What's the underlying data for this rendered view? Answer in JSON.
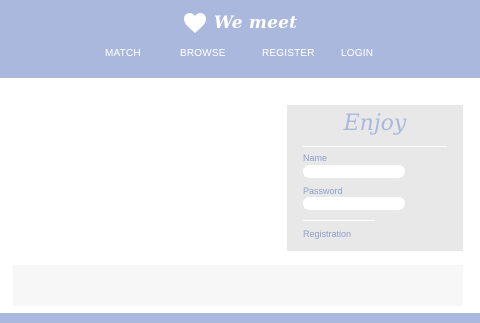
{
  "brand": {
    "name": "We meet",
    "icon": "heart-icon"
  },
  "nav": {
    "items": [
      {
        "label": "MATCH"
      },
      {
        "label": "BROWSE"
      },
      {
        "label": "REGISTER"
      },
      {
        "label": "LOGIN"
      }
    ]
  },
  "login_card": {
    "title": "Enjoy",
    "name_label": "Name",
    "name_value": "",
    "password_label": "Password",
    "password_value": "",
    "registration_link": "Registration"
  },
  "colors": {
    "accent": "#aab8dd",
    "label": "#8f9fce",
    "card_bg": "#e8e8e8"
  }
}
